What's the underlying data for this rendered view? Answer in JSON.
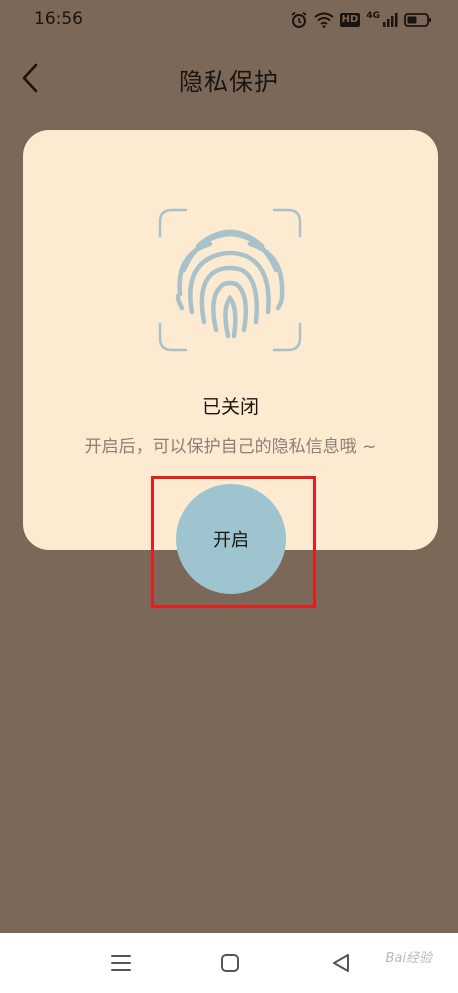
{
  "status_bar": {
    "time": "16:56",
    "hd_badge": "HD",
    "network": "4G",
    "icons": [
      "alarm-icon",
      "wifi-icon",
      "hd-icon",
      "signal-icon",
      "battery-icon"
    ]
  },
  "header": {
    "title": "隐私保护",
    "back_icon": "chevron-left-icon"
  },
  "card": {
    "fingerprint_icon": "fingerprint-icon",
    "status": "已关闭",
    "description": "开启后，可以保护自己的隐私信息哦 ~"
  },
  "enable_button": {
    "label": "开启"
  },
  "nav_bar": {
    "icons": [
      "menu-icon",
      "home-icon",
      "back-icon"
    ]
  },
  "watermark": {
    "text": "Bai经验"
  },
  "colors": {
    "background": "#7b6859",
    "card": "#fcebd0",
    "button": "#9dc4cf",
    "fingerprint": "#a9c2c9",
    "highlight": "#e02020"
  }
}
